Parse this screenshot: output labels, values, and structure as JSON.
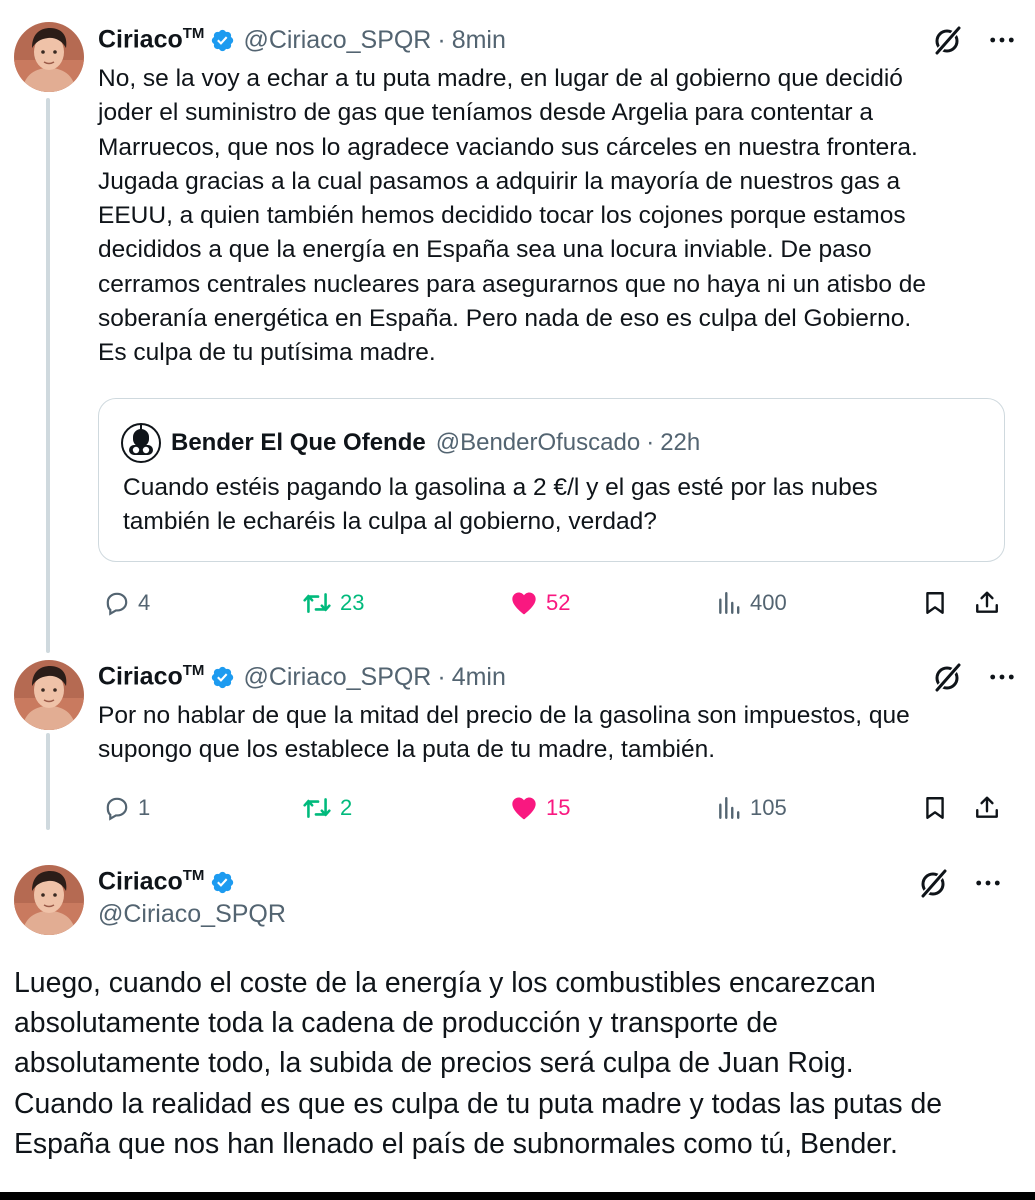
{
  "tweets": [
    {
      "name": "Ciriaco",
      "tm": "TM",
      "handle": "@Ciriaco_SPQR",
      "separator": "·",
      "time": "8min",
      "text": "No, se la voy a echar a tu puta madre, en lugar de al gobierno que decidió\njoder el suministro de gas que teníamos desde Argelia para contentar a\nMarruecos, que nos lo agradece vaciando sus cárceles en nuestra frontera.\nJugada gracias a la cual pasamos a adquirir la mayoría de nuestros gas a\nEEUU, a quien también hemos decidido tocar los cojones porque estamos\ndecididos a que la energía en España sea una locura inviable. De paso\ncerramos centrales nucleares para asegurarnos que no haya ni un atisbo de\nsoberanía energética en España. Pero nada de eso es culpa del Gobierno.\nEs culpa de tu putísima madre.",
      "quote": {
        "name": "Bender El Que Ofende",
        "handle": "@BenderOfuscado",
        "separator": "·",
        "time": "22h",
        "text": "Cuando estéis pagando la gasolina a 2 €/l y el gas esté por las nubes\ntambién le echaréis la culpa al gobierno, verdad?"
      },
      "stats": {
        "replies": "4",
        "retweets": "23",
        "likes": "52",
        "views": "400"
      }
    },
    {
      "name": "Ciriaco",
      "tm": "TM",
      "handle": "@Ciriaco_SPQR",
      "separator": "·",
      "time": "4min",
      "text": "Por no hablar de que la mitad del precio de la gasolina son impuestos, que\nsupongo que los establece la puta de tu madre, también.",
      "stats": {
        "replies": "1",
        "retweets": "2",
        "likes": "15",
        "views": "105"
      }
    }
  ],
  "main_tweet": {
    "name": "Ciriaco",
    "tm": "TM",
    "handle": "@Ciriaco_SPQR",
    "text": "Luego, cuando el coste de la energía y los combustibles encarezcan\nabsolutamente toda la cadena de producción y transporte de\nabsolutamente todo, la subida de precios será culpa de Juan Roig.\nCuando la realidad es que es culpa de tu puta madre y todas las putas de\nEspaña que nos han llenado el país de subnormales como tú, Bender."
  },
  "colors": {
    "verified": "#1d9bf0",
    "retweet": "#00ba7c",
    "like": "#f91880",
    "muted": "#536471",
    "border": "#cfd9de"
  },
  "icons": [
    "verified-badge-icon",
    "grok-icon",
    "more-icon",
    "reply-icon",
    "retweet-icon",
    "like-heart-icon",
    "views-icon",
    "bookmark-icon",
    "share-icon"
  ]
}
